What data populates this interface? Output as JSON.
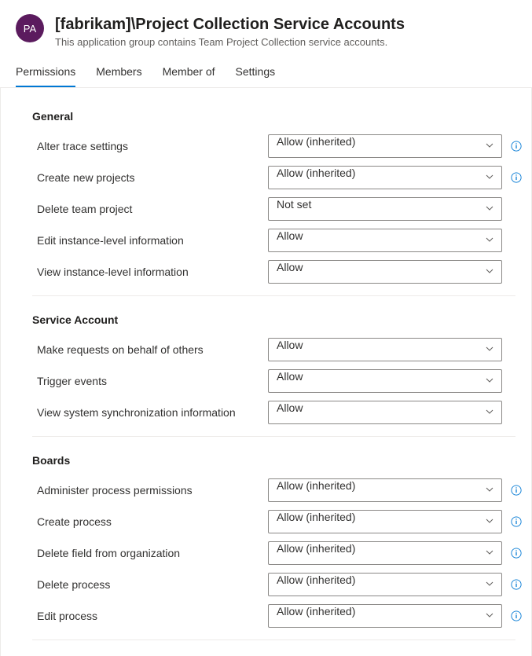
{
  "header": {
    "avatar_initials": "PA",
    "title": "[fabrikam]\\Project Collection Service Accounts",
    "subtitle": "This application group contains Team Project Collection service accounts."
  },
  "tabs": [
    {
      "label": "Permissions",
      "active": true
    },
    {
      "label": "Members",
      "active": false
    },
    {
      "label": "Member of",
      "active": false
    },
    {
      "label": "Settings",
      "active": false
    }
  ],
  "sections": [
    {
      "title": "General",
      "rows": [
        {
          "label": "Alter trace settings",
          "value": "Allow (inherited)",
          "info": true
        },
        {
          "label": "Create new projects",
          "value": "Allow (inherited)",
          "info": true
        },
        {
          "label": "Delete team project",
          "value": "Not set",
          "info": false
        },
        {
          "label": "Edit instance-level information",
          "value": "Allow",
          "info": false
        },
        {
          "label": "View instance-level information",
          "value": "Allow",
          "info": false
        }
      ]
    },
    {
      "title": "Service Account",
      "rows": [
        {
          "label": "Make requests on behalf of others",
          "value": "Allow",
          "info": false
        },
        {
          "label": "Trigger events",
          "value": "Allow",
          "info": false
        },
        {
          "label": "View system synchronization information",
          "value": "Allow",
          "info": false
        }
      ]
    },
    {
      "title": "Boards",
      "rows": [
        {
          "label": "Administer process permissions",
          "value": "Allow (inherited)",
          "info": true
        },
        {
          "label": "Create process",
          "value": "Allow (inherited)",
          "info": true
        },
        {
          "label": "Delete field from organization",
          "value": "Allow (inherited)",
          "info": true
        },
        {
          "label": "Delete process",
          "value": "Allow (inherited)",
          "info": true
        },
        {
          "label": "Edit process",
          "value": "Allow (inherited)",
          "info": true
        }
      ]
    }
  ]
}
